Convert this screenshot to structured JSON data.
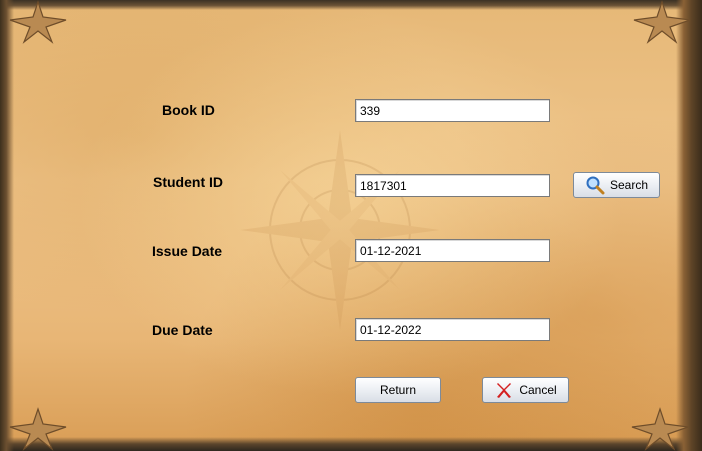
{
  "form": {
    "book_id_label": "Book ID",
    "student_id_label": "Student ID",
    "issue_date_label": "Issue Date",
    "due_date_label": "Due Date",
    "book_id_value": "339",
    "student_id_value": "1817301",
    "issue_date_value": "01-12-2021",
    "due_date_value": "01-12-2022"
  },
  "buttons": {
    "search_label": "Search",
    "return_label": "Return",
    "cancel_label": "Cancel"
  },
  "icons": {
    "search": "magnifier-icon",
    "cancel": "red-x-icon",
    "corners": "star-ornament-icon"
  },
  "colors": {
    "parchment": "#eec48a",
    "frame": "#3b3124",
    "cancel_icon": "#d42020",
    "search_icon": "#3a7fd0"
  }
}
